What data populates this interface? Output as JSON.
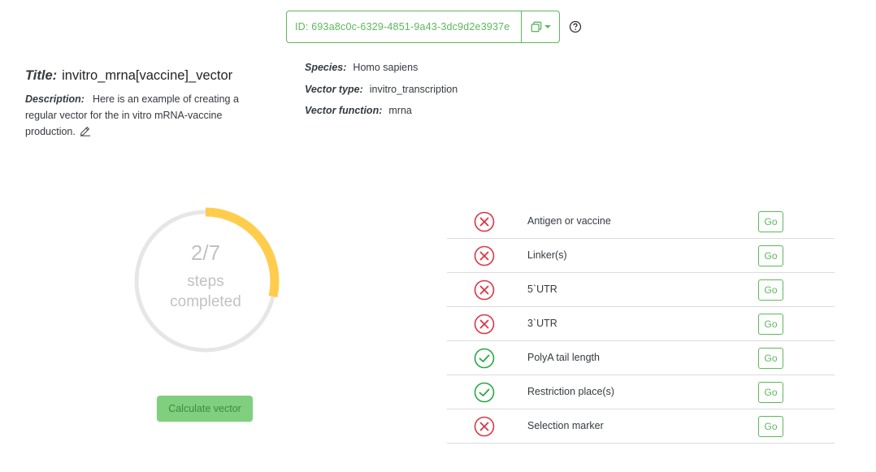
{
  "header": {
    "id_text": "ID: 693a8c0c-6329-4851-9a43-3dc9d2e3937e",
    "copy_icon": "copy-icon",
    "caret_icon": "caret-down-icon",
    "help_icon": "question-circle-icon"
  },
  "info": {
    "title_label": "Title:",
    "title_value": "invitro_mrna[vaccine]_vector",
    "description_label": "Description:",
    "description_value": "Here is an example of creating a regular vector for the in vitro mRNA-vaccine production.",
    "species_label": "Species:",
    "species_value": "Homo sapiens",
    "vector_type_label": "Vector type:",
    "vector_type_value": "invitro_transcription",
    "vector_function_label": "Vector function:",
    "vector_function_value": "mrna"
  },
  "progress": {
    "count_text": "2/7",
    "sub_line1": "steps",
    "sub_line2": "completed",
    "completed": 2,
    "total": 7,
    "color": "#ffcc4d",
    "track_color": "#e6e6e6"
  },
  "actions": {
    "calculate_label": "Calculate vector"
  },
  "steps": [
    {
      "label": "Antigen or vaccine",
      "status": "incomplete",
      "go": "Go"
    },
    {
      "label": "Linker(s)",
      "status": "incomplete",
      "go": "Go"
    },
    {
      "label": "5`UTR",
      "status": "incomplete",
      "go": "Go"
    },
    {
      "label": "3`UTR",
      "status": "incomplete",
      "go": "Go"
    },
    {
      "label": "PolyA tail length",
      "status": "complete",
      "go": "Go"
    },
    {
      "label": "Restriction place(s)",
      "status": "complete",
      "go": "Go"
    },
    {
      "label": "Selection marker",
      "status": "incomplete",
      "go": "Go"
    }
  ],
  "colors": {
    "accent": "#5cb85c",
    "error": "#dc3545",
    "success": "#28a745"
  }
}
